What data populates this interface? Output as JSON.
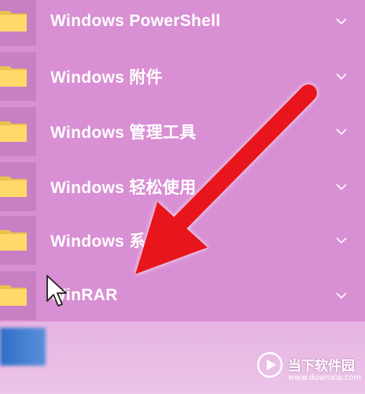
{
  "start_menu": {
    "items": [
      {
        "label": "Windows PowerShell",
        "icon": "folder-icon",
        "expand_icon": "chevron-down-icon"
      },
      {
        "label": "Windows 附件",
        "icon": "folder-icon",
        "expand_icon": "chevron-down-icon"
      },
      {
        "label": "Windows 管理工具",
        "icon": "folder-icon",
        "expand_icon": "chevron-down-icon"
      },
      {
        "label": "Windows 轻松使用",
        "icon": "folder-icon",
        "expand_icon": "chevron-down-icon"
      },
      {
        "label": "Windows 系",
        "icon": "folder-icon",
        "expand_icon": "chevron-down-icon"
      },
      {
        "label": "WinRAR",
        "icon": "folder-icon",
        "expand_icon": "chevron-down-icon"
      }
    ]
  },
  "annotation": {
    "icon": "red-arrow-icon",
    "color": "#e8141c"
  },
  "watermark": {
    "title": "当下软件园",
    "url": "www.downxia.com"
  },
  "colors": {
    "background": "#d98fd3",
    "folder": "#ffd96a",
    "text": "#ffffff"
  }
}
